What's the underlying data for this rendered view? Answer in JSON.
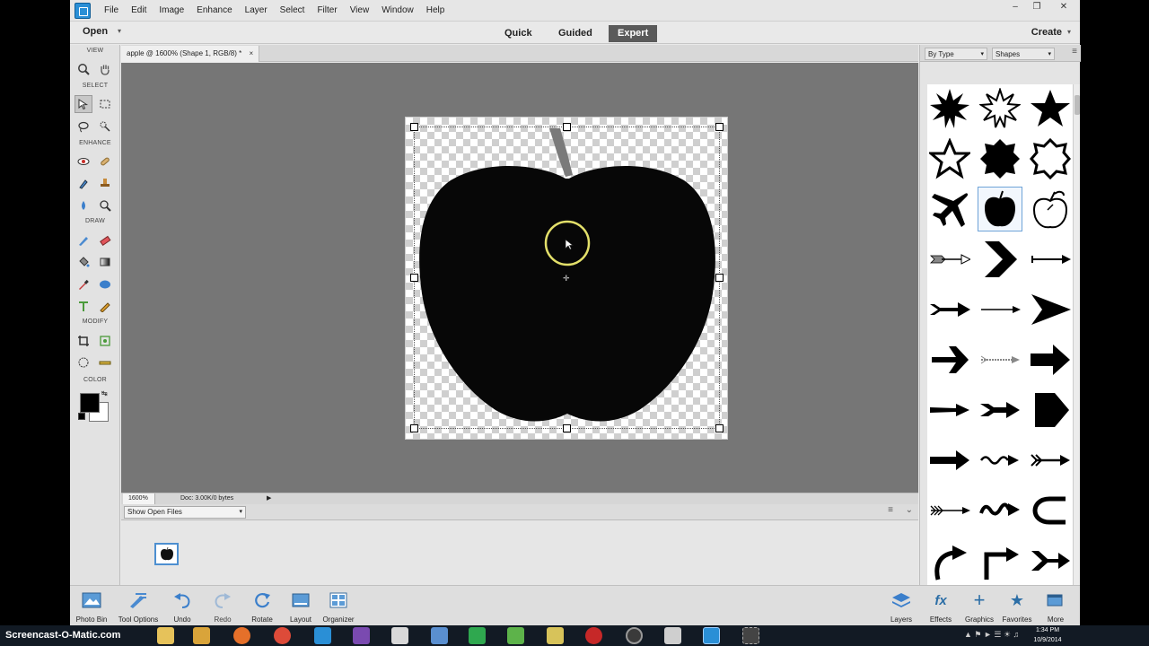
{
  "app": {
    "menu": [
      "File",
      "Edit",
      "Image",
      "Enhance",
      "Layer",
      "Select",
      "Filter",
      "View",
      "Window",
      "Help"
    ],
    "window_controls": [
      "–",
      "❐",
      "✕"
    ]
  },
  "modebar": {
    "open_label": "Open",
    "tabs": [
      "Quick",
      "Guided",
      "Expert"
    ],
    "active_tab": "Expert",
    "create_label": "Create"
  },
  "tools": {
    "sections": [
      "VIEW",
      "SELECT",
      "ENHANCE",
      "DRAW",
      "MODIFY",
      "COLOR"
    ],
    "foreground_color": "#000000",
    "background_color": "#ffffff"
  },
  "document": {
    "tab_title": "apple @ 1600% (Shape 1, RGB/8) *",
    "close_glyph": "×",
    "zoom": "1600%",
    "doc_info": "Doc: 3.00K/0 bytes"
  },
  "photo_bin": {
    "filter": "Show Open Files"
  },
  "shapes_panel": {
    "category_filter": "By Type",
    "library": "Shapes"
  },
  "bottombar": {
    "left": [
      {
        "label": "Photo Bin",
        "icon": "photo-bin-icon"
      },
      {
        "label": "Tool Options",
        "icon": "tool-options-icon"
      },
      {
        "label": "Undo",
        "icon": "undo-icon"
      },
      {
        "label": "Redo",
        "icon": "redo-icon"
      },
      {
        "label": "Rotate",
        "icon": "rotate-icon"
      },
      {
        "label": "Layout",
        "icon": "layout-icon"
      },
      {
        "label": "Organizer",
        "icon": "organizer-icon"
      }
    ],
    "right": [
      {
        "label": "Layers",
        "icon": "layers-icon"
      },
      {
        "label": "Effects",
        "icon": "effects-icon"
      },
      {
        "label": "Graphics",
        "icon": "graphics-icon"
      },
      {
        "label": "Favorites",
        "icon": "favorites-icon"
      },
      {
        "label": "More",
        "icon": "more-icon"
      }
    ]
  },
  "taskbar": {
    "watermark": "Screencast-O-Matic.com",
    "time": "1:34 PM",
    "date": "10/9/2014"
  },
  "colors": {
    "accent": "#2c6ea6",
    "active_tab_bg": "#5a5a5a",
    "canvas_bg": "#767676"
  }
}
